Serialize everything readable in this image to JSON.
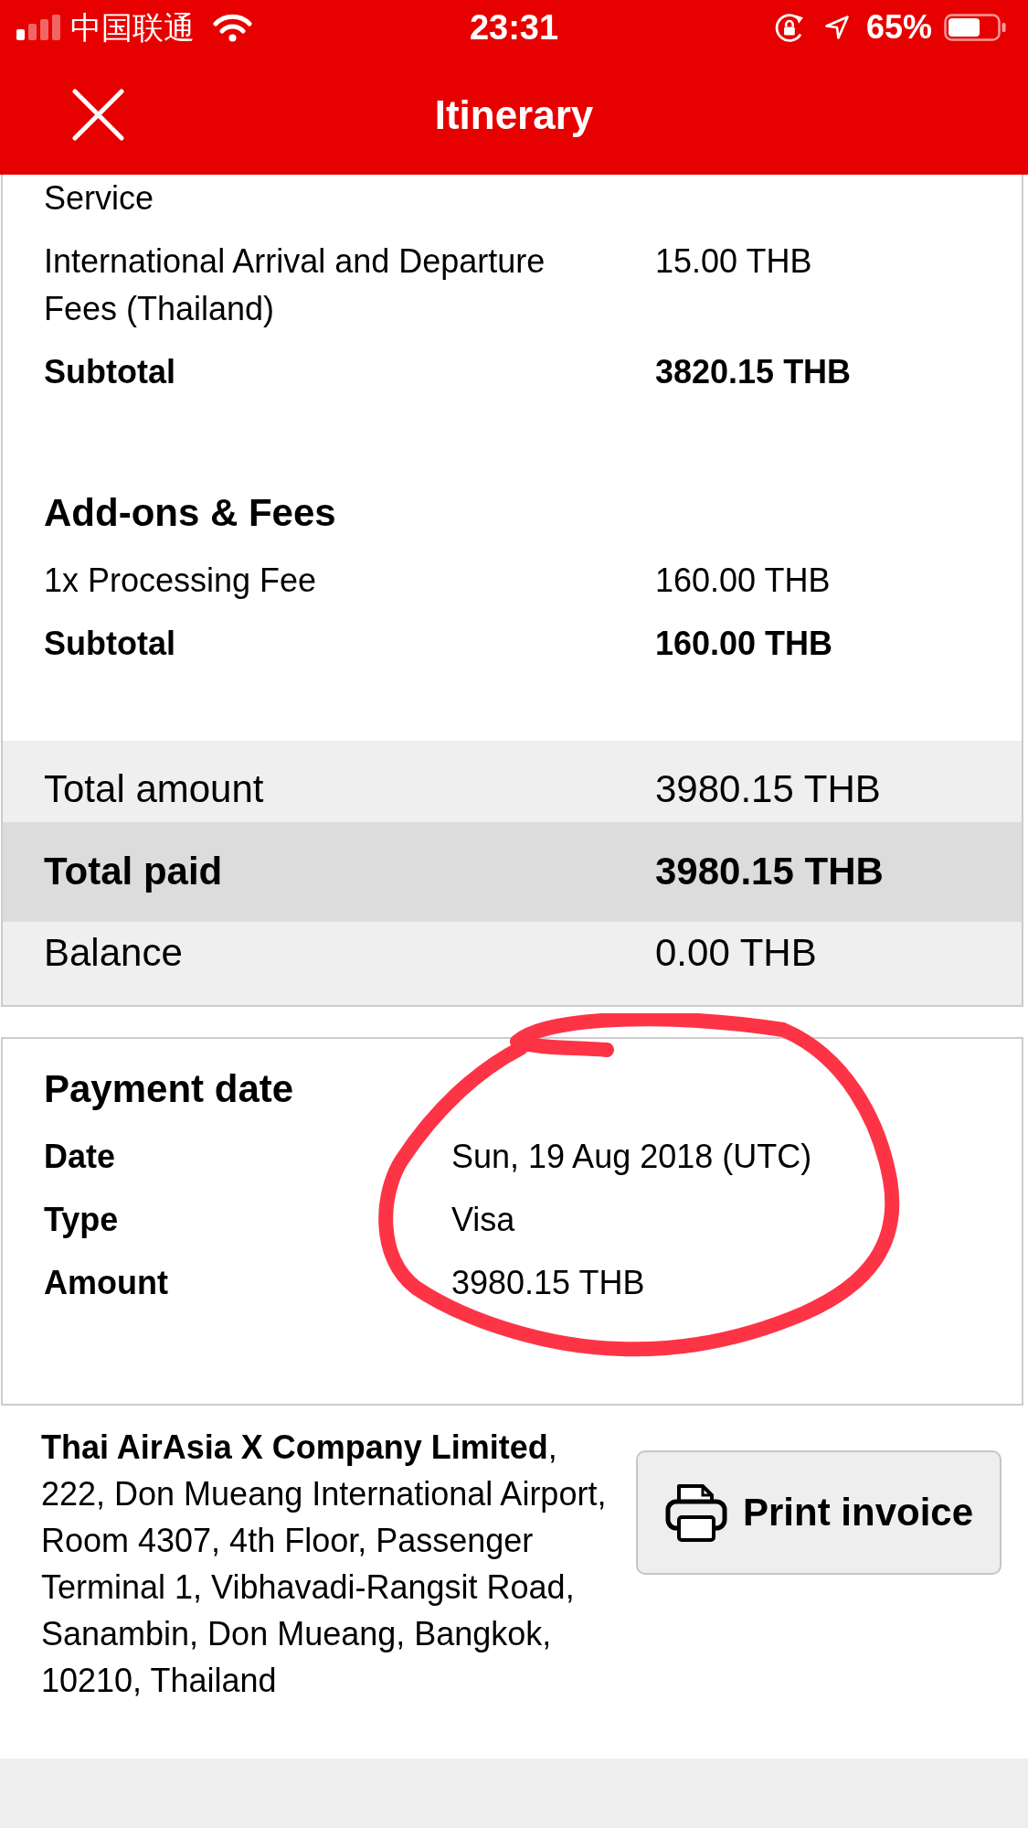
{
  "status_bar": {
    "carrier": "中国联通",
    "time": "23:31",
    "battery": "65%"
  },
  "header": {
    "title": "Itinerary"
  },
  "sections": [
    {
      "rows": [
        {
          "kind": "item",
          "label": "Service"
        },
        {
          "kind": "item",
          "label": "International Arrival and Departure Fees (Thailand)",
          "amount": "15.00 THB"
        },
        {
          "kind": "subtotal",
          "label": "Subtotal",
          "amount": "3820.15 THB"
        }
      ]
    },
    {
      "title": "Add-ons & Fees",
      "rows": [
        {
          "kind": "item",
          "label": "1x Processing Fee",
          "amount": "160.00 THB"
        },
        {
          "kind": "subtotal",
          "label": "Subtotal",
          "amount": "160.00 THB"
        }
      ]
    }
  ],
  "totals": [
    {
      "kind": "total",
      "label": "Total amount",
      "amount": "3980.15 THB"
    },
    {
      "kind": "paid",
      "label": "Total paid",
      "amount": "3980.15 THB"
    },
    {
      "kind": "balance",
      "label": "Balance",
      "amount": "0.00 THB"
    }
  ],
  "payment": {
    "title": "Payment date",
    "circled": true,
    "rows": [
      {
        "label": "Date",
        "value": "Sun, 19 Aug 2018 (UTC)"
      },
      {
        "label": "Type",
        "value": "Visa"
      },
      {
        "label": "Amount",
        "value": "3980.15 THB"
      }
    ]
  },
  "footer": {
    "address": "**Thai AirAsia X Company Limited**, 222, Don Mueang International Airport, Room 4307, 4th Floor, Passenger Terminal 1, Vibhavadi-Rangsit Road, Sanambin, Don Mueang, Bangkok, 10210, Thailand",
    "print_button": "Print invoice"
  }
}
